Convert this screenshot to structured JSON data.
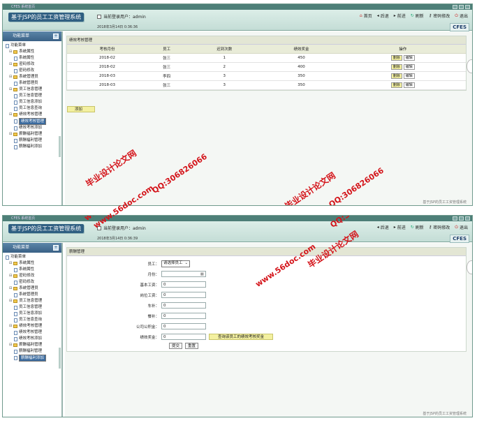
{
  "app": {
    "window_caption": "CFES 系统首页",
    "system_title": "基于JSP的员工工资管理系统",
    "current_user_label": "当前登录用户：admin",
    "brand": "CFES",
    "footer": "基于JSP的员工工资管理系统"
  },
  "topnav": [
    {
      "label": "首页",
      "icon": "home-icon"
    },
    {
      "label": "后退",
      "icon": "back-icon"
    },
    {
      "label": "前进",
      "icon": "forward-icon"
    },
    {
      "label": "刷新",
      "icon": "refresh-icon"
    },
    {
      "label": "密码修改",
      "icon": "key-icon"
    },
    {
      "label": "退出",
      "icon": "exit-icon"
    }
  ],
  "sidebar": {
    "header": "功能菜单",
    "root": "功能菜单",
    "groups": [
      {
        "label": "系统属性",
        "items": [
          "系统属性"
        ]
      },
      {
        "label": "密码修改",
        "items": [
          "密码修改"
        ]
      },
      {
        "label": "系统管理员",
        "items": [
          "系统管理员"
        ]
      },
      {
        "label": "员工信息管理",
        "items": [
          "员工信息管理",
          "员工信息添加",
          "员工信息查询"
        ]
      },
      {
        "label": "绩效考核管理",
        "items": [
          "绩效考核管理",
          "绩效考核添加"
        ]
      },
      {
        "label": "薪酬福利管理",
        "items": [
          "薪酬福利管理",
          "薪酬福利添加"
        ]
      }
    ]
  },
  "screen1": {
    "date": "2018年3月14日  0:36:36",
    "panel_title": "绩效考核管理",
    "columns": [
      "考核月份",
      "员工",
      "迟到次数",
      "绩效奖金",
      "操作"
    ],
    "rows": [
      {
        "month": "2018-02",
        "emp": "张三",
        "late": "1",
        "bonus": "450"
      },
      {
        "month": "2018-02",
        "emp": "张三",
        "late": "2",
        "bonus": "400"
      },
      {
        "month": "2018-03",
        "emp": "李四",
        "late": "3",
        "bonus": "350"
      },
      {
        "month": "2018-03",
        "emp": "张三",
        "late": "3",
        "bonus": "350"
      }
    ],
    "delete_label": "删除",
    "edit_label": "编辑",
    "add_label": "添加"
  },
  "screen2": {
    "date": "2018年3月14日  0:36:39",
    "panel_title": "薪酬管理",
    "fields": [
      {
        "label": "员工：",
        "type": "select",
        "value": "请选择员工"
      },
      {
        "label": "月份：",
        "type": "date",
        "value": ""
      },
      {
        "label": "基本工资：",
        "type": "input",
        "value": "0"
      },
      {
        "label": "岗位工资：",
        "type": "input",
        "value": "0"
      },
      {
        "label": "车补：",
        "type": "input",
        "value": "0"
      },
      {
        "label": "餐补：",
        "type": "input",
        "value": "0"
      },
      {
        "label": "公司公积金：",
        "type": "input",
        "value": "0"
      },
      {
        "label": "绩效奖金：",
        "type": "input",
        "value": "0"
      }
    ],
    "query_button": "查询该员工的绩效考核奖金",
    "submit_label": "提交",
    "reset_label": "重置"
  },
  "watermarks": {
    "site": "www.56doc.com",
    "qq": "QQ:306826066",
    "brand": "毕业设计论文网"
  },
  "colors": {
    "accent": "#3a6186",
    "title_bg": "#2f5f82",
    "header_bg": "#c4ddd6",
    "button_yellow": "#f3f0a0",
    "watermark_red": "#d4141a"
  }
}
